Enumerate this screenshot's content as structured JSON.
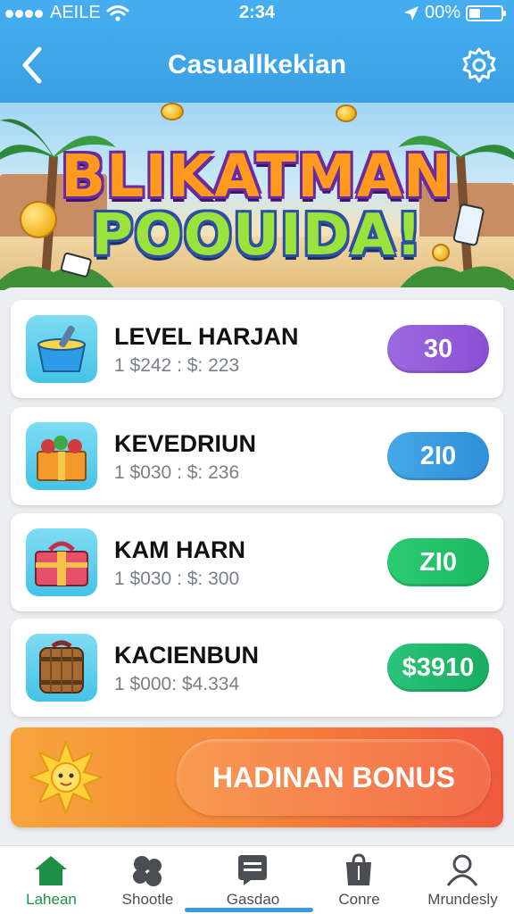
{
  "status_bar": {
    "carrier": "AEILE",
    "time": "2:34",
    "battery": "00%"
  },
  "header": {
    "title": "Casuallkekian",
    "icons": [
      "chevron-left-icon",
      "gear-icon"
    ]
  },
  "banner": {
    "line1": "BLIKATMAN",
    "line2": "POOUIDA!"
  },
  "items": [
    {
      "name": "LEVEL HARJAN",
      "subtitle": "1 $242 : $: 223",
      "price": "30",
      "icon": "bucket-icon",
      "color": "#9a5fdc"
    },
    {
      "name": "KEVEDRIUN",
      "subtitle": "1 $030 : $: 236",
      "price": "2I0",
      "icon": "gift-box-icon",
      "color": "#3a9de0"
    },
    {
      "name": "KAM HARN",
      "subtitle": "1 $030 : $: 300",
      "price": "ZI0",
      "icon": "chest-icon",
      "color": "#24c26a"
    },
    {
      "name": "KACIENBUN",
      "subtitle": "1 $000: $4.334",
      "price": "$3910",
      "icon": "barrel-icon",
      "color": "#22bf72"
    }
  ],
  "bonus": {
    "label": "HADINAN BONUS",
    "icon": "sun-icon"
  },
  "tabs": [
    {
      "label": "Lahean",
      "icon": "home-icon",
      "active": true
    },
    {
      "label": "Shootle",
      "icon": "puzzle-icon",
      "active": false
    },
    {
      "label": "Gasdao",
      "icon": "chat-icon",
      "active": false
    },
    {
      "label": "Conre",
      "icon": "bag-icon",
      "active": false
    },
    {
      "label": "Mrundesly",
      "icon": "profile-icon",
      "active": false
    }
  ],
  "colors": {
    "header": "#3fa6ea",
    "active_tab": "#1f8f45",
    "bonus_start": "#f7a53a",
    "bonus_end": "#ef5a3e"
  }
}
